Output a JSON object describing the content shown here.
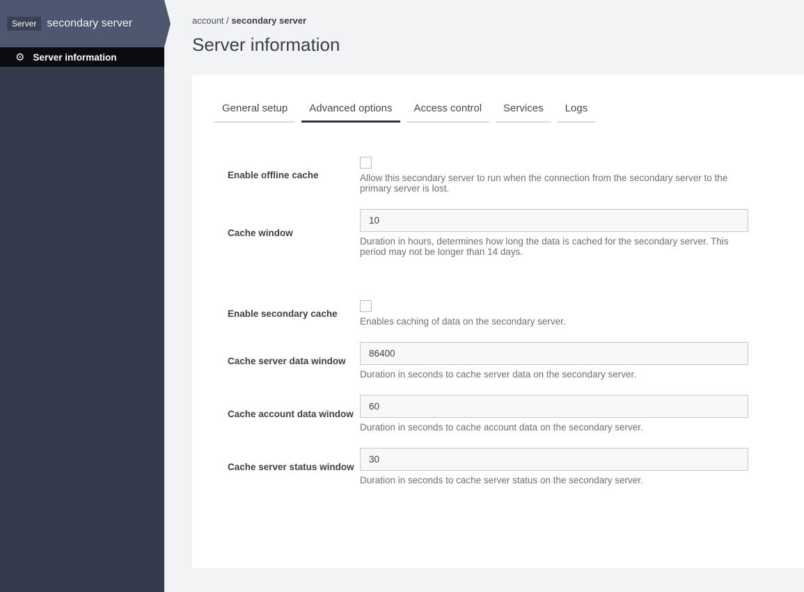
{
  "colors": {
    "sidebar_header": "#4e5770",
    "sidebar_body": "#333a4b",
    "sidebar_nav_active": "#0a0c12",
    "active_tab_underline": "#2b3447",
    "page_background": "#f2f3f5"
  },
  "sidebar": {
    "badge": "Server",
    "title": "secondary server",
    "nav_item": {
      "icon": "gear-icon",
      "label": "Server information"
    }
  },
  "breadcrumb": {
    "parent": "account",
    "separator": " / ",
    "current": "secondary server"
  },
  "page": {
    "title": "Server information"
  },
  "tabs": [
    {
      "label": "General setup",
      "active": false
    },
    {
      "label": "Advanced options",
      "active": true
    },
    {
      "label": "Access control",
      "active": false
    },
    {
      "label": "Services",
      "active": false
    },
    {
      "label": "Logs",
      "active": false
    }
  ],
  "form": {
    "fields": [
      {
        "type": "checkbox",
        "label": "Enable offline cache",
        "checked": false,
        "description": "Allow this secondary server to run when the connection from the secondary server to the primary server is lost."
      },
      {
        "type": "text",
        "label": "Cache window",
        "value": "10",
        "description": "Duration in hours, determines how long the data is cached for the secondary server. This period may not be longer than 14 days."
      },
      {
        "type": "checkbox",
        "label": "Enable secondary cache",
        "checked": false,
        "description": "Enables caching of data on the secondary server."
      },
      {
        "type": "text",
        "label": "Cache server data window",
        "value": "86400",
        "description": "Duration in seconds to cache server data on the secondary server."
      },
      {
        "type": "text",
        "label": "Cache account data window",
        "value": "60",
        "description": "Duration in seconds to cache account data on the secondary server."
      },
      {
        "type": "text",
        "label": "Cache server status window",
        "value": "30",
        "description": "Duration in seconds to cache server status on the secondary server."
      }
    ]
  }
}
